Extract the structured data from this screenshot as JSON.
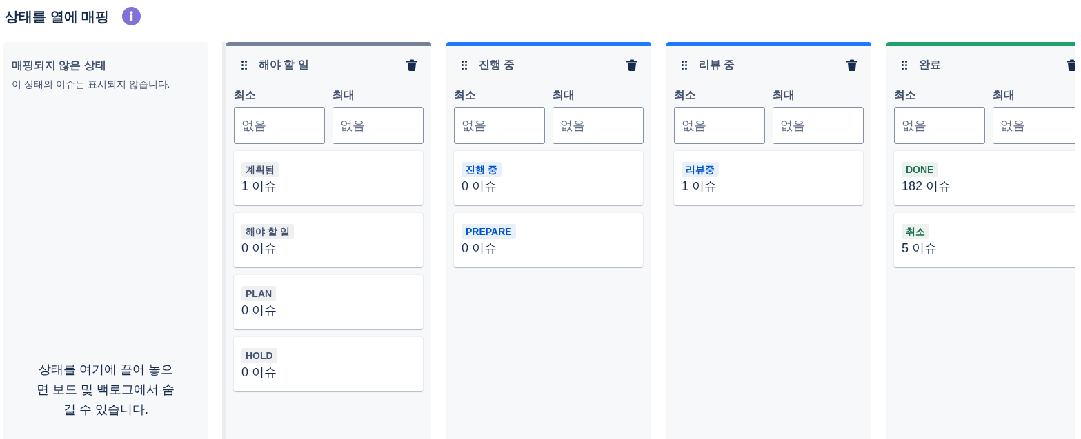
{
  "page": {
    "title": "상태를 열에 매핑"
  },
  "unmapped": {
    "title": "매핑되지 않은 상태",
    "description": "이 상태의 이슈는 표시되지 않습니다.",
    "drop_hint": "상태를 여기에 끌어 놓으면 보드 및 백로그에서 숨길 수 있습니다."
  },
  "columns": [
    {
      "name": "해야 할 일",
      "color": "#758195",
      "min": {
        "label": "최소",
        "placeholder": "없음"
      },
      "max": {
        "label": "최대",
        "placeholder": "없음"
      },
      "statuses": [
        {
          "name": "계획됨",
          "color": "#44546f",
          "count": "1 이슈"
        },
        {
          "name": "해야 할 일",
          "color": "#44546f",
          "count": "0 이슈"
        },
        {
          "name": "PLAN",
          "color": "#44546f",
          "count": "0 이슈"
        },
        {
          "name": "HOLD",
          "color": "#44546f",
          "count": "0 이슈"
        }
      ]
    },
    {
      "name": "진행 중",
      "color": "#1d7afc",
      "min": {
        "label": "최소",
        "placeholder": "없음"
      },
      "max": {
        "label": "최대",
        "placeholder": "없음"
      },
      "statuses": [
        {
          "name": "진행 중",
          "color": "#0055cc",
          "count": "0 이슈"
        },
        {
          "name": "PREPARE",
          "color": "#0055cc",
          "count": "0 이슈"
        }
      ]
    },
    {
      "name": "리뷰 중",
      "color": "#1d7afc",
      "min": {
        "label": "최소",
        "placeholder": "없음"
      },
      "max": {
        "label": "최대",
        "placeholder": "없음"
      },
      "statuses": [
        {
          "name": "리뷰중",
          "color": "#0055cc",
          "count": "1 이슈"
        }
      ]
    },
    {
      "name": "완료",
      "color": "#22a06b",
      "min": {
        "label": "최소",
        "placeholder": "없음"
      },
      "max": {
        "label": "최대",
        "placeholder": "없음"
      },
      "statuses": [
        {
          "name": "DONE",
          "color": "#216e4e",
          "count": "182 이슈"
        },
        {
          "name": "취소",
          "color": "#216e4e",
          "count": "5 이슈"
        }
      ]
    }
  ]
}
